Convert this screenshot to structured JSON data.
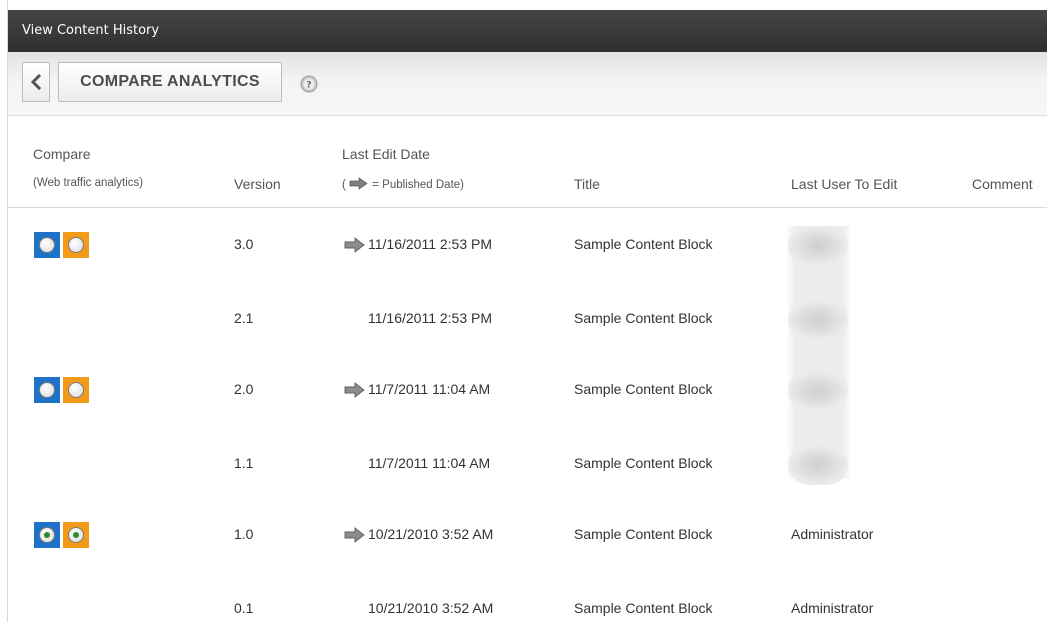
{
  "window": {
    "title": "View Content History"
  },
  "toolbar": {
    "back_label": "",
    "analytics_label": "COMPARE ANALYTICS"
  },
  "columns": {
    "compare": "Compare",
    "compare_sub": "(Web traffic analytics)",
    "version": "Version",
    "last_edit": "Last Edit Date",
    "published_note": "= Published Date)",
    "published_open": "(",
    "title": "Title",
    "last_user": "Last User To Edit",
    "comment": "Comment"
  },
  "rows": [
    {
      "version": "3.0",
      "date": "11/16/2011 2:53 PM",
      "published": true,
      "title": "Sample Content Block",
      "user": "",
      "compare": true,
      "selected": false
    },
    {
      "version": "2.1",
      "date": "11/16/2011 2:53 PM",
      "published": false,
      "title": "Sample Content Block",
      "user": "",
      "compare": false,
      "selected": false
    },
    {
      "version": "2.0",
      "date": "11/7/2011 11:04 AM",
      "published": true,
      "title": "Sample Content Block",
      "user": "",
      "compare": true,
      "selected": false
    },
    {
      "version": "1.1",
      "date": "11/7/2011 11:04 AM",
      "published": false,
      "title": "Sample Content Block",
      "user": "",
      "compare": false,
      "selected": false
    },
    {
      "version": "1.0",
      "date": "10/21/2010 3:52 AM",
      "published": true,
      "title": "Sample Content Block",
      "user": "Administrator",
      "compare": true,
      "selected": true
    },
    {
      "version": "0.1",
      "date": "10/21/2010 3:52 AM",
      "published": false,
      "title": "Sample Content Block",
      "user": "Administrator",
      "compare": false,
      "selected": false
    }
  ],
  "icons": {
    "back": "chevron-left-icon",
    "help": "help-icon",
    "published": "arrow-right-icon",
    "compare_radio": "radio-icon"
  },
  "colors": {
    "titlebar": "#3a3a3a",
    "compare_blue": "#1e72c7",
    "compare_orange": "#f39a18",
    "arrow": "#8c8c8c"
  }
}
